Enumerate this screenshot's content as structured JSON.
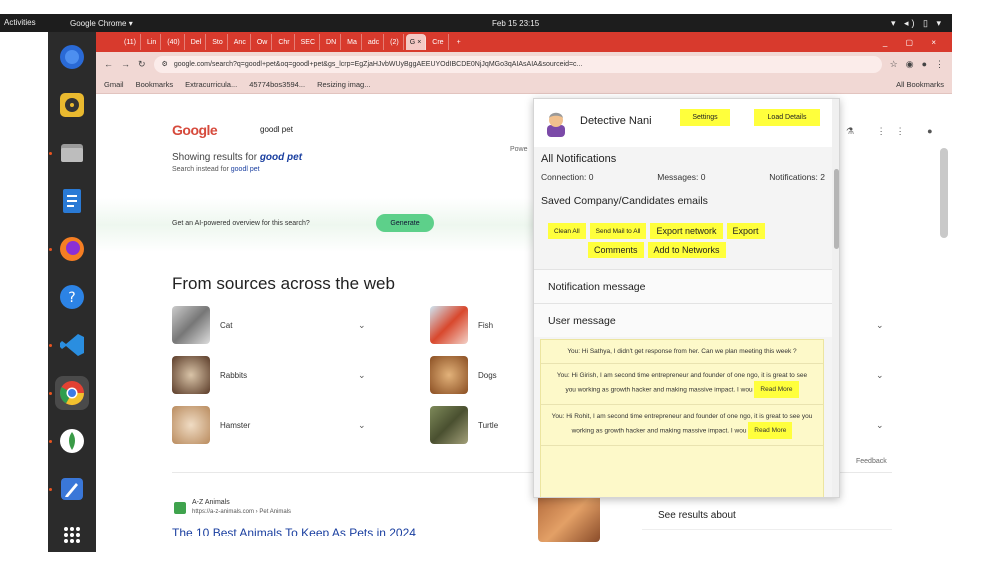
{
  "topbar": {
    "activities": "Activities",
    "app_name": "Google Chrome ▾",
    "clock": "Feb 15 23:15",
    "tray": "▾ ◂) ▯ ▾"
  },
  "dock": {
    "items": [
      "firefox-icon",
      "rhythmbox-icon",
      "files-icon",
      "writer-icon",
      "firefox-dev-icon",
      "help-icon",
      "vscode-icon",
      "chrome-icon",
      "mongodb-icon",
      "text-editor-icon",
      "app-grid-icon"
    ]
  },
  "tabs": [
    {
      "label": "(11)"
    },
    {
      "label": "Lin"
    },
    {
      "label": "(40)"
    },
    {
      "label": "Del"
    },
    {
      "label": "Sto"
    },
    {
      "label": "Anc"
    },
    {
      "label": "Ow"
    },
    {
      "label": "Chr"
    },
    {
      "label": "SEC"
    },
    {
      "label": "DN"
    },
    {
      "label": "Ma"
    },
    {
      "label": "adc"
    },
    {
      "label": "(2)"
    },
    {
      "label": "G",
      "active": true
    },
    {
      "label": "Cre"
    }
  ],
  "toolbar": {
    "url": "google.com/search?q=goodl+pet&oq=goodl+pet&gs_lcrp=EgZjaHJvbWUyBggAEEUYOdIBCDE0NjJqMGo3qAIAsAIA&sourceid=c..."
  },
  "bookmarks": {
    "gmail": "Gmail",
    "bookmarks": "Bookmarks",
    "extracurricular": "Extracurricula...",
    "file": "45774bos3594...",
    "resizing": "Resizing imag...",
    "all": "All Bookmarks"
  },
  "google": {
    "logo": "Google",
    "query": "goodl pet",
    "powered": "Powe",
    "showing_prefix": "Showing results for ",
    "showing_term": "good pet",
    "instead_prefix": "Search instead for ",
    "instead_term": "goodl pet",
    "ai_text": "Get an AI-powered overview for this search?",
    "ai_button": "Generate",
    "sources_title": "From sources across the web",
    "animals": [
      "Cat",
      "Fish",
      "Rabbits",
      "Dogs",
      "Hamster",
      "Turtle"
    ],
    "feedback": "Feedback",
    "result_site": "A-Z Animals",
    "result_url": "https://a-z-animals.com › Pet Animals",
    "result_title": "The 10 Best Animals To Keep As Pets in 2024",
    "see_results": "See results about"
  },
  "popup": {
    "user": "Detective Nani",
    "settings": "Settings",
    "load": "Load Details",
    "all_notifications": "All Notifications",
    "connection": "Connection: 0",
    "messages": "Messages: 0",
    "notifications": "Notifications: 2",
    "saved": "Saved Company/Candidates emails",
    "btn_clean": "Clean All",
    "btn_send": "Send Mail to All",
    "btn_export_network": "Export network",
    "btn_export_comments_a": "Export",
    "btn_export_comments_b": "Comments",
    "btn_add": "Add to Networks",
    "notification_message": "Notification message",
    "user_message": "User message",
    "messages_list": [
      {
        "text": "You: Hi Sathya, I didn't get response from her. Can we plan meeting this week ?"
      },
      {
        "text": "You: Hi Girish, I am second time entrepreneur and founder of one ngo, it is great to see you working as growth hacker and making massive impact. I wou",
        "more": "Read More"
      },
      {
        "text": "You: Hi Rohit, I am second time entrepreneur and founder of one ngo, it is great to see you working as growth hacker and making massive impact. I wou",
        "more": "Read More"
      }
    ]
  }
}
